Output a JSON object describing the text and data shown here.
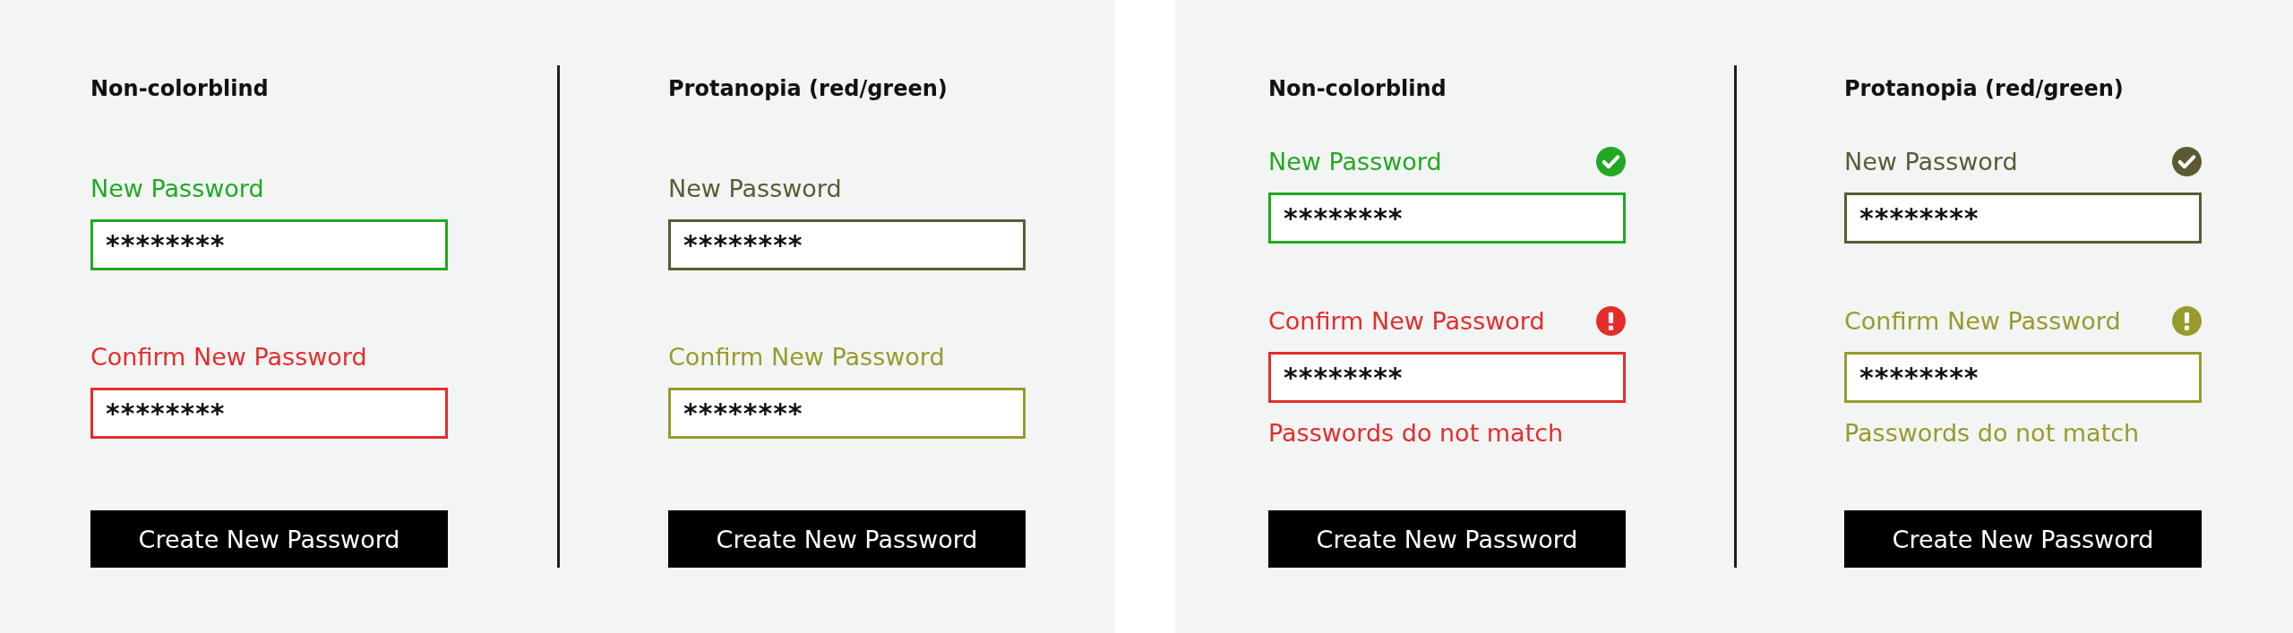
{
  "panels": [
    {
      "columns": [
        {
          "heading": "Non-colorblind",
          "fields": [
            {
              "label": "New Password",
              "value": "********",
              "color": "#22a822"
            },
            {
              "label": "Confirm New Password",
              "value": "********",
              "color": "#e32d2d"
            }
          ],
          "button": "Create New Password"
        },
        {
          "heading": "Protanopia (red/green)",
          "fields": [
            {
              "label": "New Password",
              "value": "********",
              "color": "#5b5a34"
            },
            {
              "label": "Confirm New Password",
              "value": "********",
              "color": "#999a2c"
            }
          ],
          "button": "Create New Password"
        }
      ]
    },
    {
      "columns": [
        {
          "heading": "Non-colorblind",
          "fields": [
            {
              "kind": "valid",
              "label": "New Password",
              "value": "********",
              "color": "#22a822"
            },
            {
              "kind": "invalid",
              "label": "Confirm New Password",
              "value": "********",
              "color": "#e32d2d",
              "error": "Passwords do not match"
            }
          ],
          "button": "Create New Password"
        },
        {
          "heading": "Protanopia (red/green)",
          "fields": [
            {
              "kind": "valid",
              "label": "New Password",
              "value": "********",
              "color": "#5b5a34"
            },
            {
              "kind": "invalid",
              "label": "Confirm New Password",
              "value": "********",
              "color": "#999a2c",
              "error": "Passwords do not match"
            }
          ],
          "button": "Create New Password"
        }
      ]
    }
  ]
}
